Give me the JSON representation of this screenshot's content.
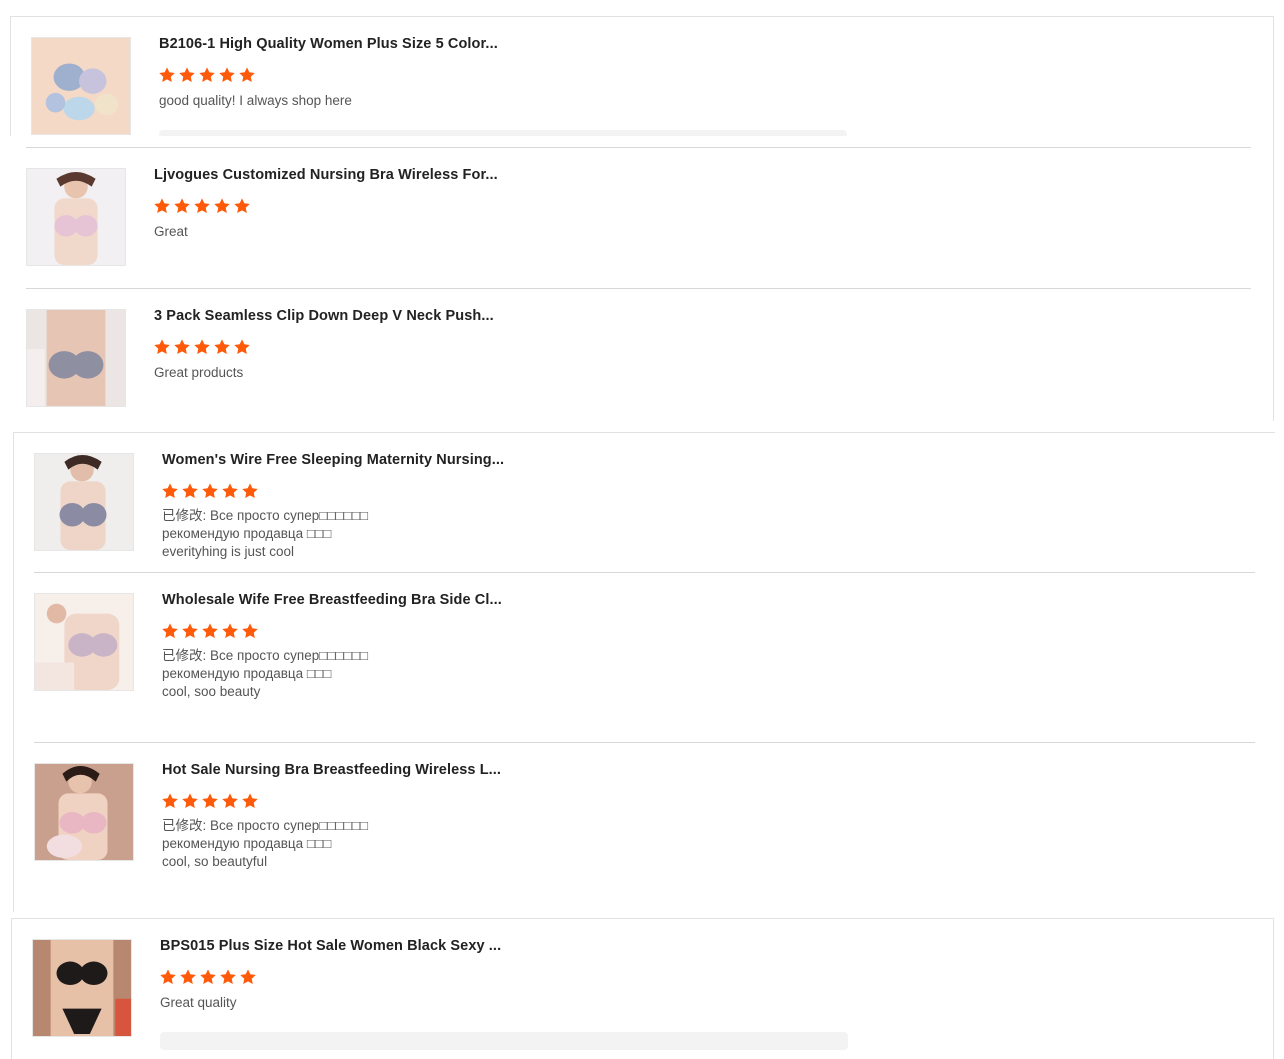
{
  "reviews": [
    {
      "title": "B2106-1 High Quality Women Plus Size 5 Color...",
      "rating": 5,
      "comment_lines": [
        "good quality! I always shop here"
      ],
      "thumb_icon": "product-thumbnail-bras-group"
    },
    {
      "title": "Ljvogues Customized Nursing Bra Wireless For...",
      "rating": 5,
      "comment_lines": [
        "Great"
      ],
      "thumb_icon": "product-thumbnail-pink-bra"
    },
    {
      "title": "3 Pack Seamless Clip Down Deep V Neck Push...",
      "rating": 5,
      "comment_lines": [
        "Great products"
      ],
      "thumb_icon": "product-thumbnail-gray-bra"
    },
    {
      "title": "Women's Wire Free Sleeping Maternity Nursing...",
      "rating": 5,
      "comment_lines": [
        "已修改: Все просто супер□□□□□□",
        "рекомендую продавца □□□",
        " everityhing is just cool"
      ],
      "thumb_icon": "product-thumbnail-gray-nursing-bra"
    },
    {
      "title": "Wholesale Wife Free Breastfeeding Bra Side Cl...",
      "rating": 5,
      "comment_lines": [
        "已修改: Все просто супер□□□□□□",
        "рекомендую продавца □□□",
        "cool, soo beauty"
      ],
      "thumb_icon": "product-thumbnail-lace-bra"
    },
    {
      "title": "Hot Sale Nursing Bra Breastfeeding Wireless L...",
      "rating": 5,
      "comment_lines": [
        "已修改: Все просто супер□□□□□□",
        "рекомендую продавца □□□",
        "cool, so beautyful"
      ],
      "thumb_icon": "product-thumbnail-pink-nursing-bra"
    },
    {
      "title": "BPS015 Plus Size Hot Sale Women Black Sexy ...",
      "rating": 5,
      "comment_lines": [
        "Great quality"
      ],
      "thumb_icon": "product-thumbnail-black-lingerie"
    }
  ],
  "colors": {
    "star": "#ff5a0a",
    "divider": "#d8d8d8",
    "comment": "#555555",
    "title": "#222222"
  }
}
